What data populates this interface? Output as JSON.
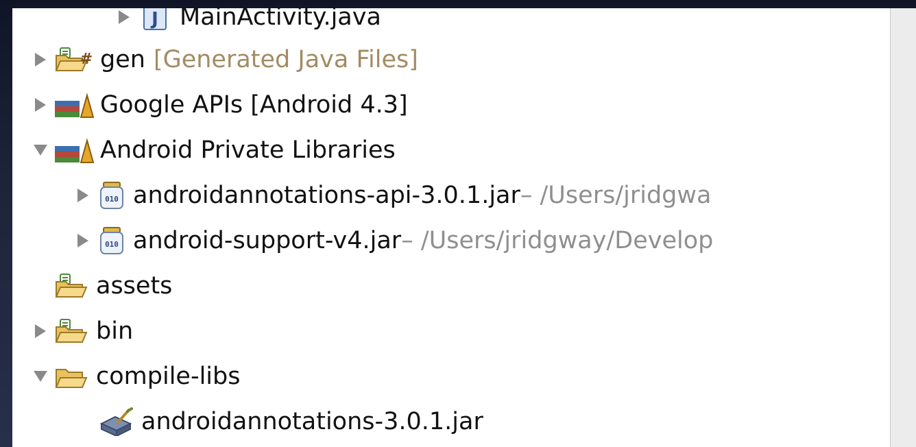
{
  "tree": {
    "items": [
      {
        "label": "MainActivity.java",
        "decoration": "",
        "path": "",
        "expanded": "collapsed",
        "icon": "java-file-icon"
      },
      {
        "label": "gen",
        "decoration": "[Generated Java Files]",
        "path": "",
        "expanded": "collapsed",
        "icon": "source-folder-icon"
      },
      {
        "label": "Google APIs [Android 4.3]",
        "decoration": "",
        "path": "",
        "expanded": "collapsed",
        "icon": "library-icon"
      },
      {
        "label": "Android Private Libraries",
        "decoration": "",
        "path": "",
        "expanded": "expanded",
        "icon": "library-icon"
      },
      {
        "label": "androidannotations-api-3.0.1.jar",
        "decoration": "",
        "path": " – /Users/jridgwa",
        "expanded": "collapsed",
        "icon": "jar-icon"
      },
      {
        "label": "android-support-v4.jar",
        "decoration": "",
        "path": " – /Users/jridgway/Develop",
        "expanded": "collapsed",
        "icon": "jar-icon"
      },
      {
        "label": "assets",
        "decoration": "",
        "path": "",
        "expanded": "none",
        "icon": "source-folder-icon"
      },
      {
        "label": "bin",
        "decoration": "",
        "path": "",
        "expanded": "collapsed",
        "icon": "source-folder-icon"
      },
      {
        "label": "compile-libs",
        "decoration": "",
        "path": "",
        "expanded": "expanded",
        "icon": "folder-icon"
      },
      {
        "label": "androidannotations-3.0.1.jar",
        "decoration": "",
        "path": "",
        "expanded": "none",
        "icon": "jar-file-icon"
      }
    ]
  }
}
